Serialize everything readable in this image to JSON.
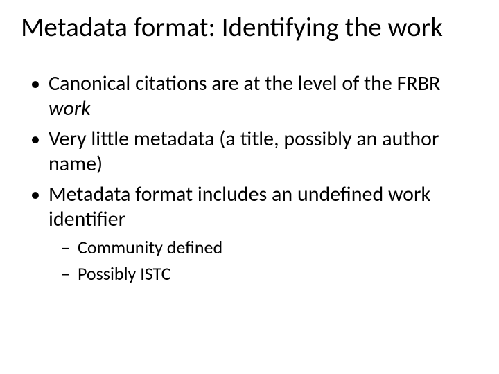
{
  "title": "Metadata format: Identifying the work",
  "bullets": {
    "b1_pre": "Canonical citations are at the level of the FRBR ",
    "b1_it": "work",
    "b2": "Very little metadata (a title, possibly an author name)",
    "b3": "Metadata format includes an undefined work identifier",
    "b3_sub1": "Community defined",
    "b3_sub2": "Possibly ISTC"
  }
}
